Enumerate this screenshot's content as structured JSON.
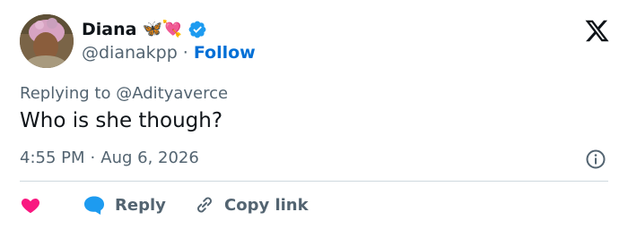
{
  "author": {
    "display_name": "Diana",
    "name_emojis": "🦋💘",
    "handle": "@dianakpp",
    "separator": "·",
    "follow_label": "Follow",
    "verified_color": "#1d9bf0"
  },
  "reply_context": {
    "prefix": "Replying to",
    "mention": "@Adityaverce"
  },
  "tweet": {
    "text": "Who is she though?",
    "time": "4:55 PM",
    "separator": "·",
    "date": "Aug 6, 2026"
  },
  "actions": {
    "like_color": "#f91880",
    "reply_label": "Reply",
    "reply_color": "#1d9bf0",
    "copy_link_label": "Copy link"
  },
  "icons": [
    "x-logo-icon",
    "verified-badge-icon",
    "info-icon",
    "heart-icon",
    "reply-bubble-icon",
    "link-icon"
  ]
}
